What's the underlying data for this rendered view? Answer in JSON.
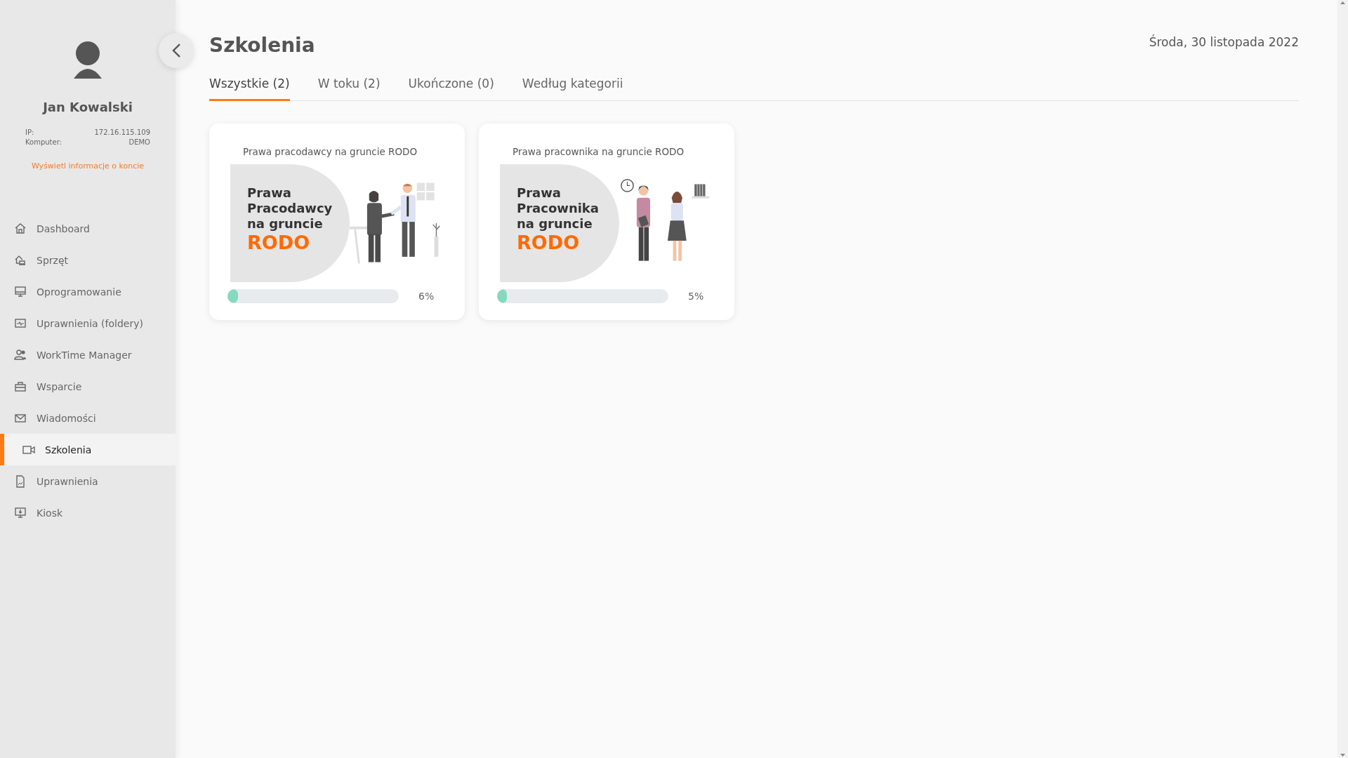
{
  "user": {
    "name": "Jan Kowalski",
    "info": [
      {
        "label": "IP:",
        "value": "172.16.115.109"
      },
      {
        "label": "Komputer:",
        "value": "DEMO"
      }
    ],
    "account_link": "Wyświetl informacje o koncie"
  },
  "sidebar": {
    "items": [
      {
        "label": "Dashboard",
        "kind": "home",
        "selected": false
      },
      {
        "label": "Sprzęt",
        "kind": "hardware",
        "selected": false
      },
      {
        "label": "Oprogramowanie",
        "kind": "monitor",
        "selected": false
      },
      {
        "label": "Uprawnienia (foldery)",
        "kind": "pulse",
        "selected": false
      },
      {
        "label": "WorkTime Manager",
        "kind": "users",
        "selected": false
      },
      {
        "label": "Wsparcie",
        "kind": "toolbox",
        "selected": false
      },
      {
        "label": "Wiadomości",
        "kind": "mail",
        "selected": false
      },
      {
        "label": "Szkolenia",
        "kind": "video",
        "selected": true
      },
      {
        "label": "Uprawnienia",
        "kind": "document",
        "selected": false
      },
      {
        "label": "Kiosk",
        "kind": "kiosk",
        "selected": false
      }
    ]
  },
  "page": {
    "title": "Szkolenia",
    "date": "Środa, 30 listopada 2022"
  },
  "tabs": [
    {
      "label": "Wszystkie (2)",
      "selected": true
    },
    {
      "label": "W toku (2)",
      "selected": false
    },
    {
      "label": "Ukończone (0)",
      "selected": false
    },
    {
      "label": "Według kategorii",
      "selected": false
    }
  ],
  "courses": [
    {
      "title": "Prawa pracodawcy na gruncie RODO",
      "thumbnail": {
        "lines": [
          "Prawa",
          "Pracodawcy",
          "na gruncie"
        ],
        "highlight": "RODO",
        "kind": "handshake"
      },
      "level": 0.06,
      "percent": "6%"
    },
    {
      "title": "Prawa pracownika na gruncie RODO",
      "thumbnail": {
        "lines": [
          "Prawa",
          "Pracownika",
          "na gruncie"
        ],
        "highlight": "RODO",
        "kind": "women"
      },
      "level": 0.05,
      "percent": "5%"
    }
  ]
}
